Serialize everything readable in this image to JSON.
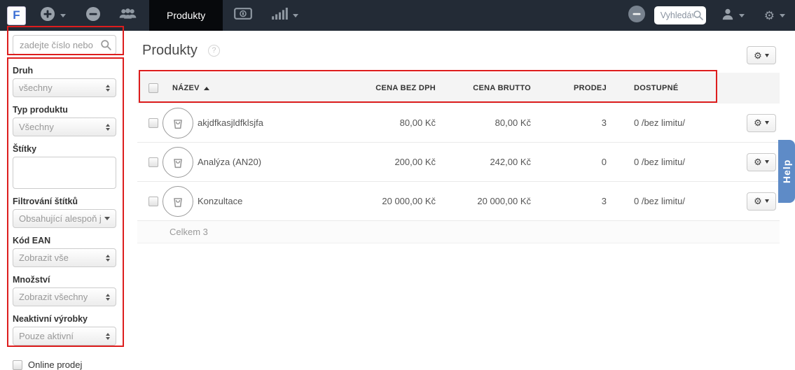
{
  "navbar": {
    "logo": "F",
    "tab_products": "Produkty",
    "search_placeholder": "Vyhledáv"
  },
  "sidebar": {
    "search_placeholder": "zadejte číslo nebo slo",
    "filters": [
      {
        "label": "Druh",
        "value": "všechny"
      },
      {
        "label": "Typ produktu",
        "value": "Všechny"
      },
      {
        "label": "Štítky",
        "value": ""
      },
      {
        "label": "Filtrování štítků",
        "value": "Obsahující alespoň je"
      },
      {
        "label": "Kód EAN",
        "value": "Zobrazit vše"
      },
      {
        "label": "Množství",
        "value": "Zobrazit všechny"
      },
      {
        "label": "Neaktivní výrobky",
        "value": "Pouze aktivní"
      }
    ],
    "online_checkbox": {
      "label": "Online prodej",
      "checked": false
    }
  },
  "main": {
    "title": "Produkty",
    "table": {
      "header": {
        "name": "NÁZEV",
        "sort_indicator": "▲",
        "price_net": "CENA BEZ DPH",
        "price_gross": "CENA BRUTTO",
        "sales": "PRODEJ",
        "available": "DOSTUPNÉ"
      },
      "rows": [
        {
          "name": "akjdfkasjldfklsjfa",
          "price_net": "80,00 Kč",
          "price_gross": "80,00 Kč",
          "sales": "3",
          "available": "0 /bez limitu/"
        },
        {
          "name": "Analýza (AN20)",
          "price_net": "200,00 Kč",
          "price_gross": "242,00 Kč",
          "sales": "0",
          "available": "0 /bez limitu/"
        },
        {
          "name": "Konzultace",
          "price_net": "20 000,00 Kč",
          "price_gross": "20 000,00 Kč",
          "sales": "3",
          "available": "0 /bez limitu/"
        }
      ],
      "footer": "Celkem 3"
    }
  },
  "help_tab": {
    "label": "Help"
  },
  "colors": {
    "navbar_bg": "#232b36",
    "active_tab_bg": "#07090c",
    "annotation_red": "#dd1d1d",
    "help_tab_blue": "#5e8bc7",
    "table_header_bg": "#f4f4f4"
  }
}
